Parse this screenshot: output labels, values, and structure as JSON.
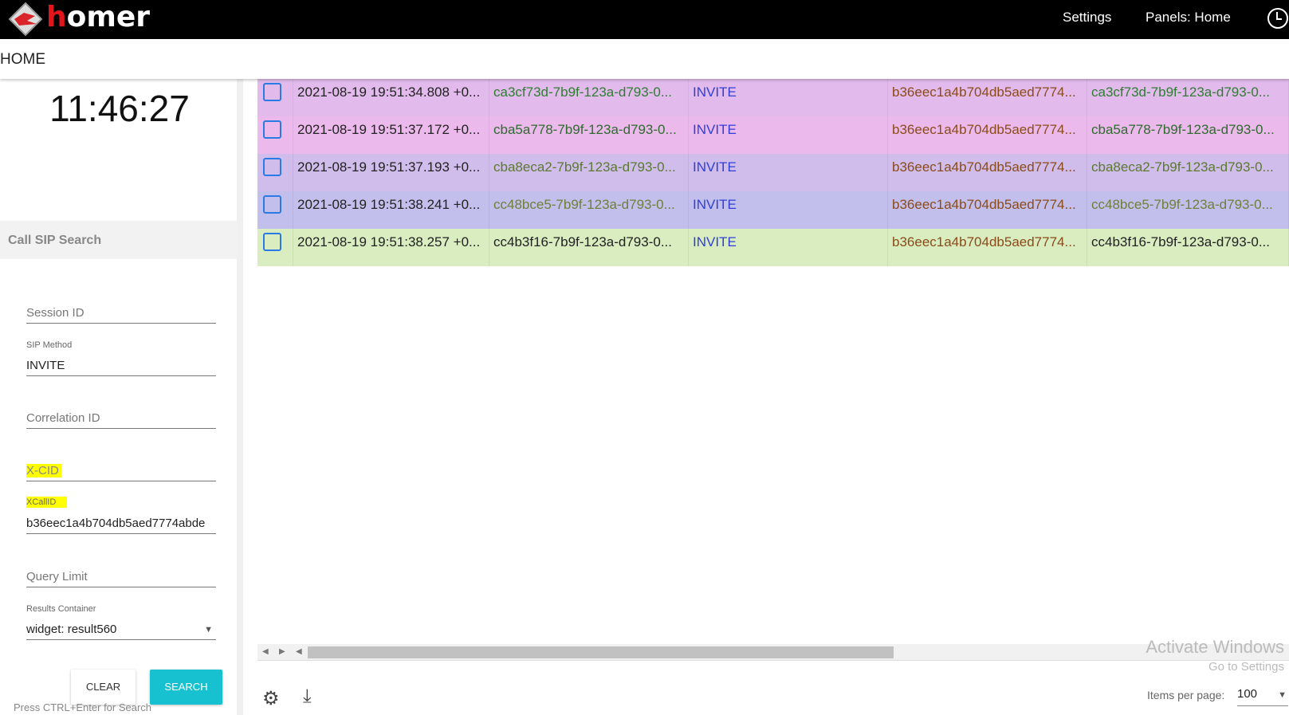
{
  "header": {
    "brand_first": "h",
    "brand_rest": "omer",
    "settings": "Settings",
    "panels": "Panels: Home"
  },
  "breadcrumb": "HOME",
  "clock": "11:46:27",
  "search_panel": {
    "title": "Call SIP Search",
    "session_id_placeholder": "Session ID",
    "sip_method_label": "SIP Method",
    "sip_method_value": "INVITE",
    "correlation_id_placeholder": "Correlation ID",
    "xcid_placeholder": "X-CID",
    "xcallid_label": "XCallID",
    "xcallid_value": "b36eec1a4b704db5aed7774abde",
    "query_limit_placeholder": "Query Limit",
    "results_container_label": "Results Container",
    "results_container_value": "widget: result560",
    "clear": "CLEAR",
    "search": "SEARCH",
    "hint": "Press CTRL+Enter for Search"
  },
  "rows": [
    {
      "date": "2021-08-19 19:51:34.808 +0...",
      "callid": "ca3cf73d-7b9f-123a-d793-0...",
      "method": "INVITE",
      "user": "b36eec1a4b704db5aed7774...",
      "callid2": "ca3cf73d-7b9f-123a-d793-0...",
      "bg": "#e2bbec",
      "c1": "#2e7d32",
      "c2": "#2e7d32"
    },
    {
      "date": "2021-08-19 19:51:37.172 +0...",
      "callid": "cba5a778-7b9f-123a-d793-0...",
      "method": "INVITE",
      "user": "b36eec1a4b704db5aed7774...",
      "callid2": "cba5a778-7b9f-123a-d793-0...",
      "bg": "#ecb9ec",
      "c1": "#2e6b2e",
      "c2": "#2e6b2e"
    },
    {
      "date": "2021-08-19 19:51:37.193 +0...",
      "callid": "cba8eca2-7b9f-123a-d793-0...",
      "method": "INVITE",
      "user": "b36eec1a4b704db5aed7774...",
      "callid2": "cba8eca2-7b9f-123a-d793-0...",
      "bg": "#d0bdeb",
      "c1": "#5a7a2e",
      "c2": "#5a7a2e"
    },
    {
      "date": "2021-08-19 19:51:38.241 +0...",
      "callid": "cc48bce5-7b9f-123a-d793-0...",
      "method": "INVITE",
      "user": "b36eec1a4b704db5aed7774...",
      "callid2": "cc48bce5-7b9f-123a-d793-0...",
      "bg": "#c3bfec",
      "c1": "#6f7f3a",
      "c2": "#6f7f3a"
    },
    {
      "date": "2021-08-19 19:51:38.257 +0...",
      "callid": "cc4b3f16-7b9f-123a-d793-0...",
      "method": "INVITE",
      "user": "b36eec1a4b704db5aed7774...",
      "callid2": "cc4b3f16-7b9f-123a-d793-0...",
      "bg": "#d9edc0",
      "c1": "#222222",
      "c2": "#222222"
    }
  ],
  "pagination": {
    "items_per_page_label": "Items per page:",
    "items_per_page": "100"
  },
  "watermark": {
    "line1": "Activate Windows",
    "line2": "Go to Settings"
  }
}
